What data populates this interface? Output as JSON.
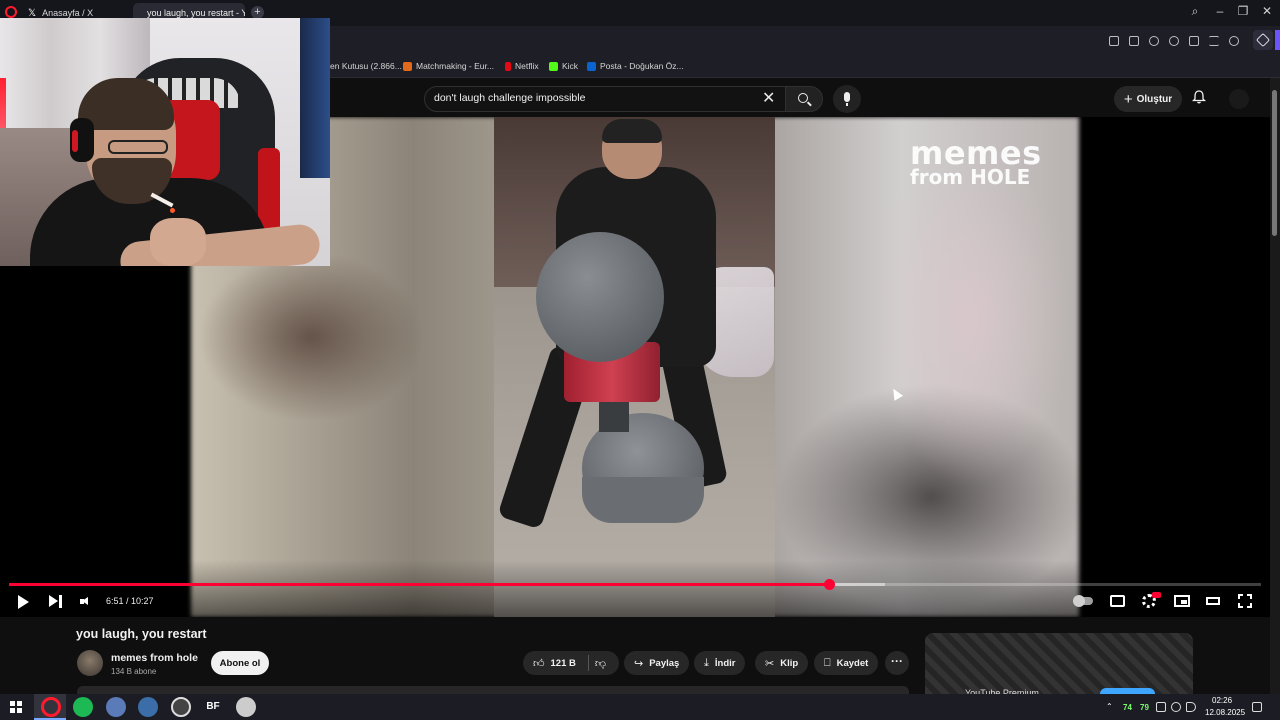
{
  "browser": {
    "tabs": [
      {
        "label": "Anasayfa / X",
        "active": false
      },
      {
        "label": "you laugh, you restart - Y",
        "active": true
      }
    ],
    "bookmarks": [
      {
        "label": "en Kutusu (2.866...",
        "icon_color": "#888888"
      },
      {
        "label": "Matchmaking - Eur...",
        "icon_color": "#e06a1a"
      },
      {
        "label": "Netflix",
        "icon_color": "#e50914"
      },
      {
        "label": "Kick",
        "icon_color": "#53fc18"
      },
      {
        "label": "Posta - Doğukan Öz...",
        "icon_color": "#0a64d0"
      }
    ],
    "accent_color": "#6b54ff"
  },
  "youtube": {
    "search": {
      "value": "don't laugh challenge impossible",
      "clear_glyph": "✕"
    },
    "create_label": "Oluştur",
    "player": {
      "watermark_line1": "memes",
      "watermark_line2": "from HOLE",
      "current_time": "6:51",
      "duration": "10:27",
      "time_display": "6:51 / 10:27",
      "progress_fraction": 0.655,
      "buffer_fraction": 0.7
    },
    "video": {
      "title": "you laugh, you restart",
      "channel": "memes from hole",
      "subscribers": "134 B abone",
      "subscribe_label": "Abone ol",
      "like_count": "121 B",
      "share_label": "Paylaş",
      "download_label": "İndir",
      "clip_label": "Klip",
      "save_label": "Kaydet",
      "more_glyph": "···"
    },
    "side_card": {
      "text": "YouTube Premium"
    }
  },
  "taskbar": {
    "apps": [
      {
        "name": "opera",
        "color": "#ff1b2d"
      },
      {
        "name": "spotify",
        "color": "#1db954"
      },
      {
        "name": "chrome-like",
        "color": "#5a7ab8"
      },
      {
        "name": "steam",
        "color": "#3b6ea8"
      },
      {
        "name": "obs",
        "color": "#444444"
      },
      {
        "name": "battlefield",
        "color": "#222222"
      },
      {
        "name": "shield",
        "color": "#cccccc"
      }
    ],
    "bf_label": "BF",
    "gpu_temp": "74",
    "cpu_temp": "79",
    "clock_time": "02:26",
    "clock_date": "12.08.2025"
  }
}
